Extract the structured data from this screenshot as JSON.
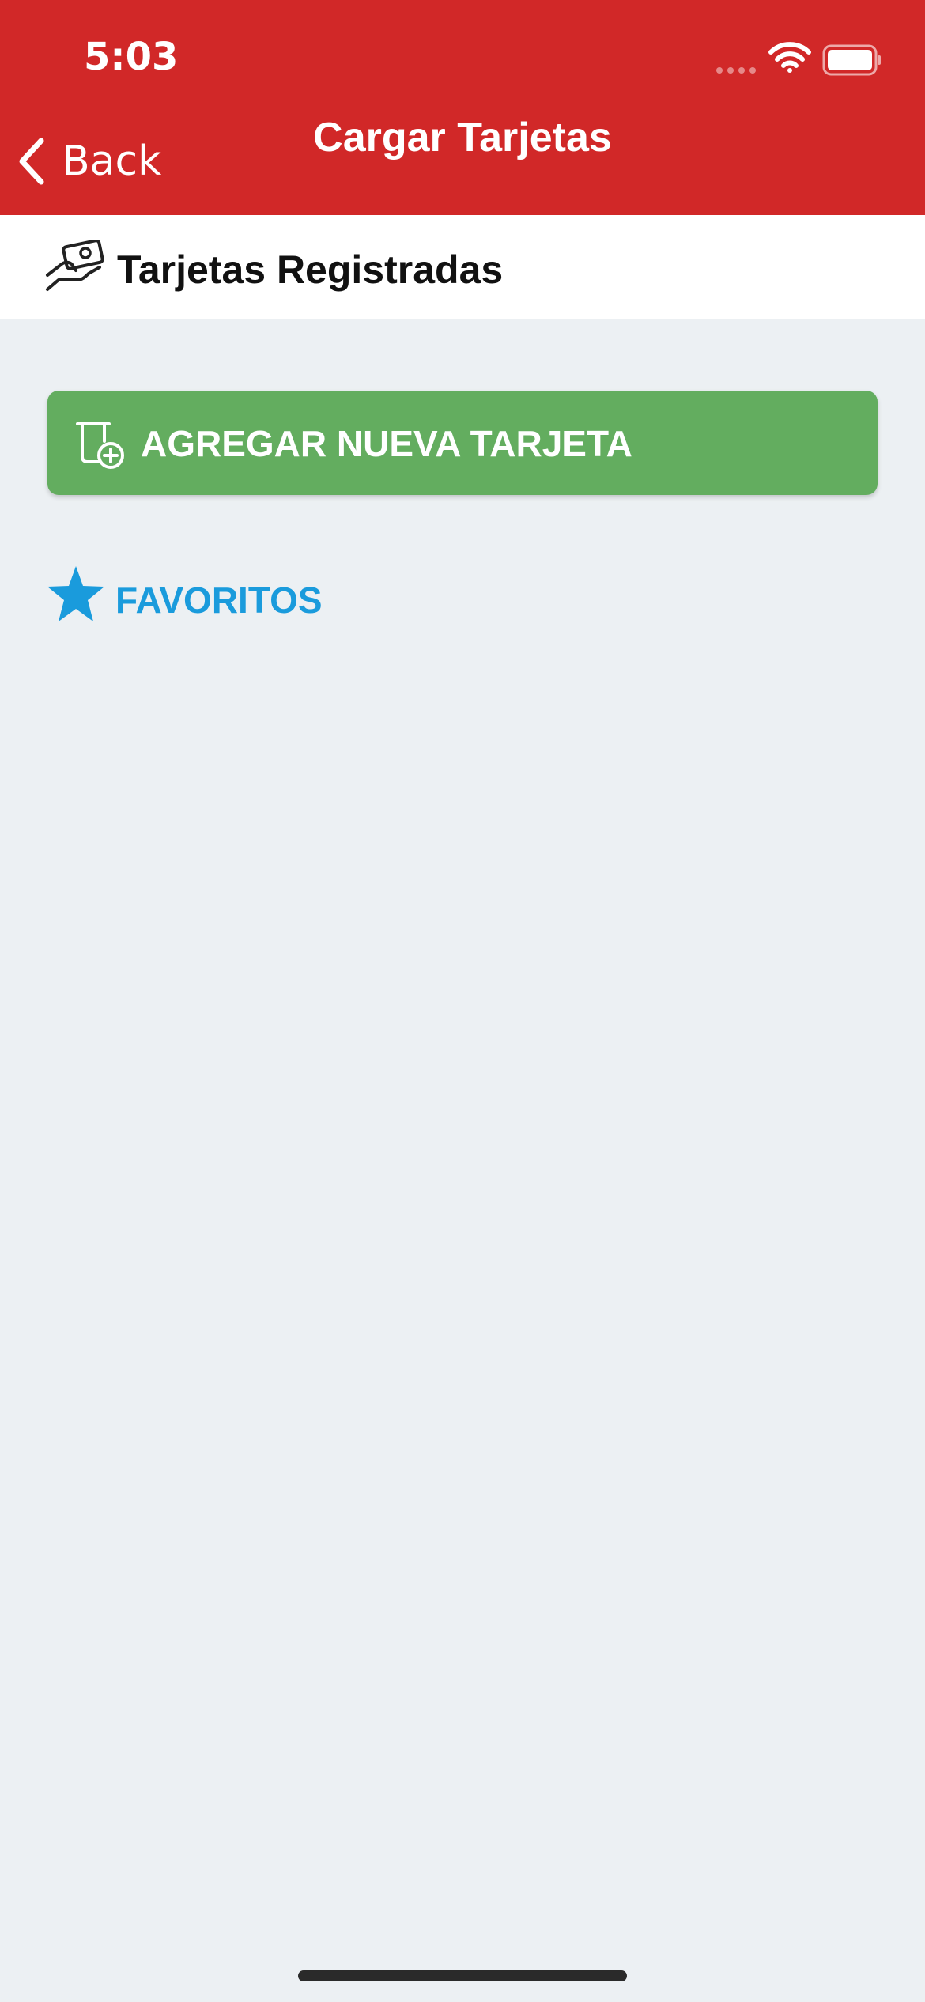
{
  "status_bar": {
    "time": "5:03"
  },
  "nav": {
    "back_label": "Back",
    "title": "Cargar Tarjetas"
  },
  "section": {
    "title": "Tarjetas Registradas",
    "icon": "card-in-hand-icon"
  },
  "actions": {
    "add_card_label": "AGREGAR NUEVA TARJETA",
    "add_card_icon": "add-card-icon"
  },
  "favorites": {
    "label": "FAVORITOS",
    "icon": "star-icon"
  },
  "colors": {
    "header": "#d12828",
    "background": "#ecf0f3",
    "add_button": "#63ad5f",
    "favorites_accent": "#1a9bdc"
  }
}
